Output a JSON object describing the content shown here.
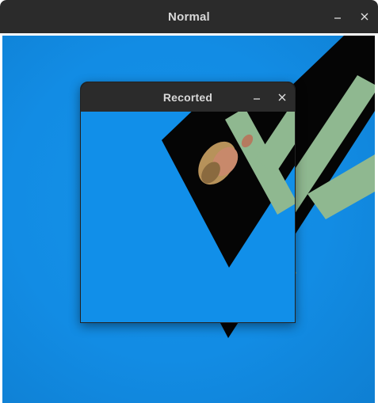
{
  "main_window": {
    "title": "Normal",
    "minimize_glyph": "–",
    "close_glyph": "✕"
  },
  "recorded_window": {
    "title": "Recorted",
    "minimize_glyph": "–",
    "close_glyph": "✕"
  },
  "colors": {
    "titlebar": "#2b2b2b",
    "background_blue": "#128ce4",
    "card_black": "#050505",
    "letter_green": "#8fb890"
  },
  "icons": {
    "minimize": "minimize-icon",
    "close": "close-icon"
  }
}
